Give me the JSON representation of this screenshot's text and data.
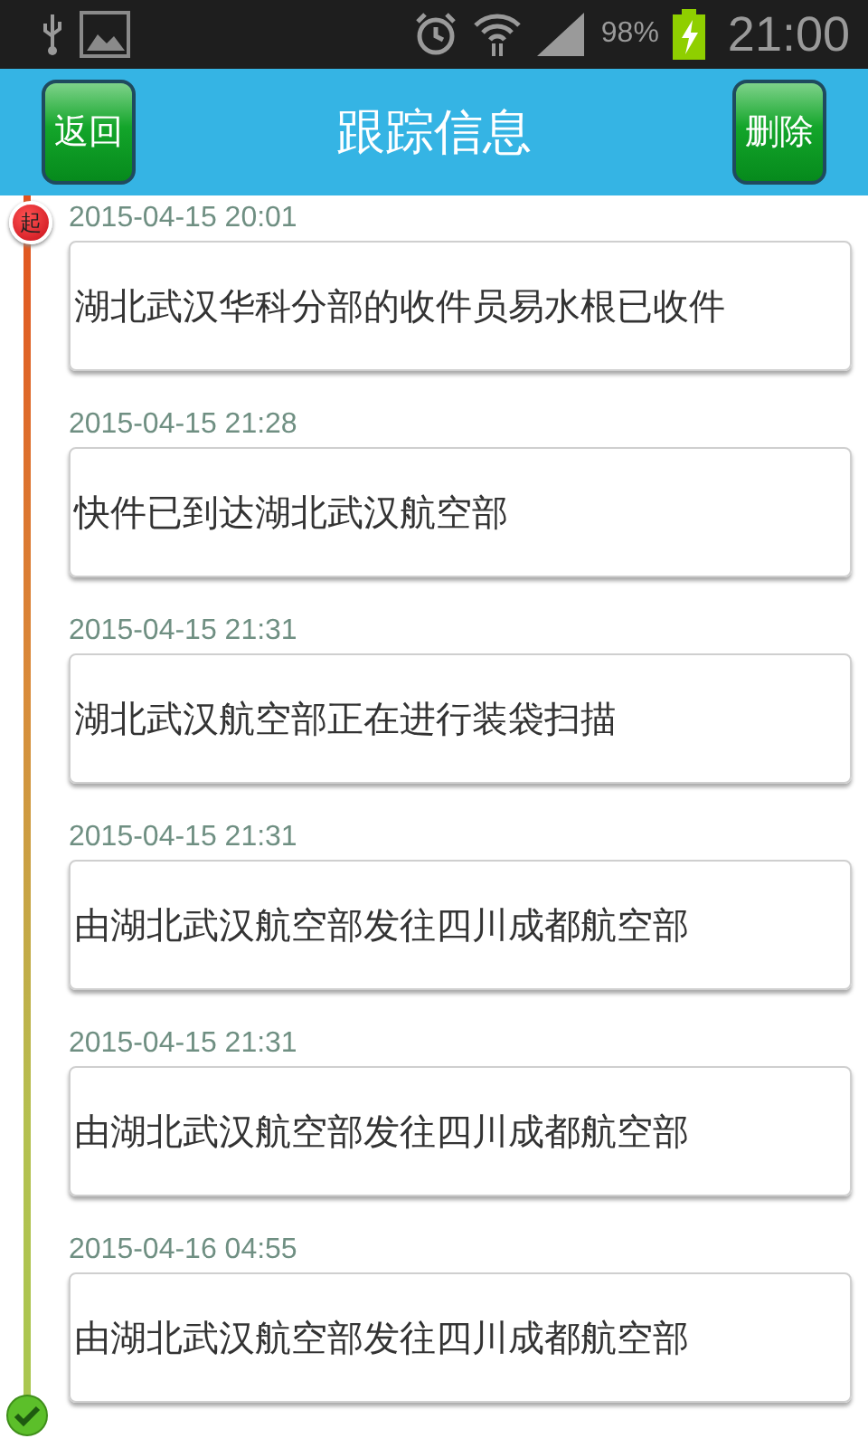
{
  "status_bar": {
    "battery_percent": "98%",
    "time": "21:00"
  },
  "header": {
    "back_button": "返回",
    "title": "跟踪信息",
    "delete_button": "删除"
  },
  "timeline": {
    "start_marker": "起",
    "events": [
      {
        "time": "2015-04-15 20:01",
        "description": "湖北武汉华科分部的收件员易水根已收件"
      },
      {
        "time": "2015-04-15 21:28",
        "description": "快件已到达湖北武汉航空部"
      },
      {
        "time": "2015-04-15 21:31",
        "description": "湖北武汉航空部正在进行装袋扫描"
      },
      {
        "time": "2015-04-15 21:31",
        "description": "由湖北武汉航空部发往四川成都航空部"
      },
      {
        "time": "2015-04-15 21:31",
        "description": "由湖北武汉航空部发往四川成都航空部"
      },
      {
        "time": "2015-04-16 04:55",
        "description": "由湖北武汉航空部发往四川成都航空部"
      }
    ]
  }
}
